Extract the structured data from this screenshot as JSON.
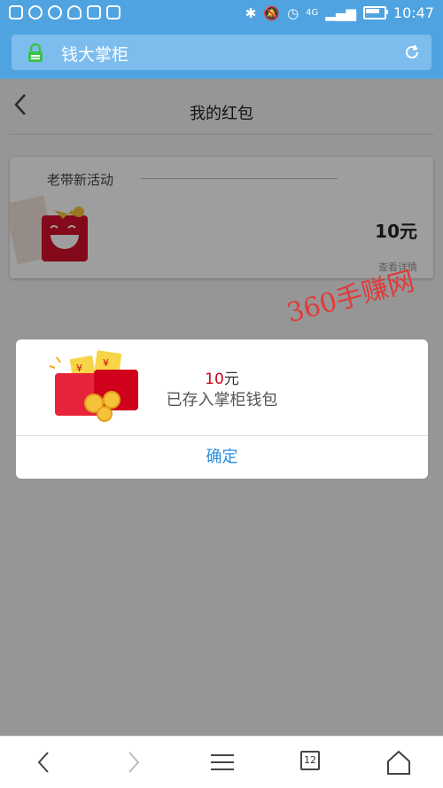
{
  "status_bar": {
    "time": "10:47",
    "network": "4G"
  },
  "browser": {
    "title": "钱大掌柜"
  },
  "page": {
    "title": "我的红包",
    "card": {
      "label": "老带新活动",
      "amount": "10元",
      "link": "查看详情"
    }
  },
  "dialog": {
    "amount_number": "10",
    "amount_unit": "元",
    "message": "已存入掌柜钱包",
    "ok_label": "确定"
  },
  "watermark": "360手赚网",
  "bottom_bar": {
    "tabs_count": "12"
  },
  "colors": {
    "accent": "#4fa3e0",
    "dialog_button": "#2a8de0",
    "amount_red": "#d0021b"
  }
}
